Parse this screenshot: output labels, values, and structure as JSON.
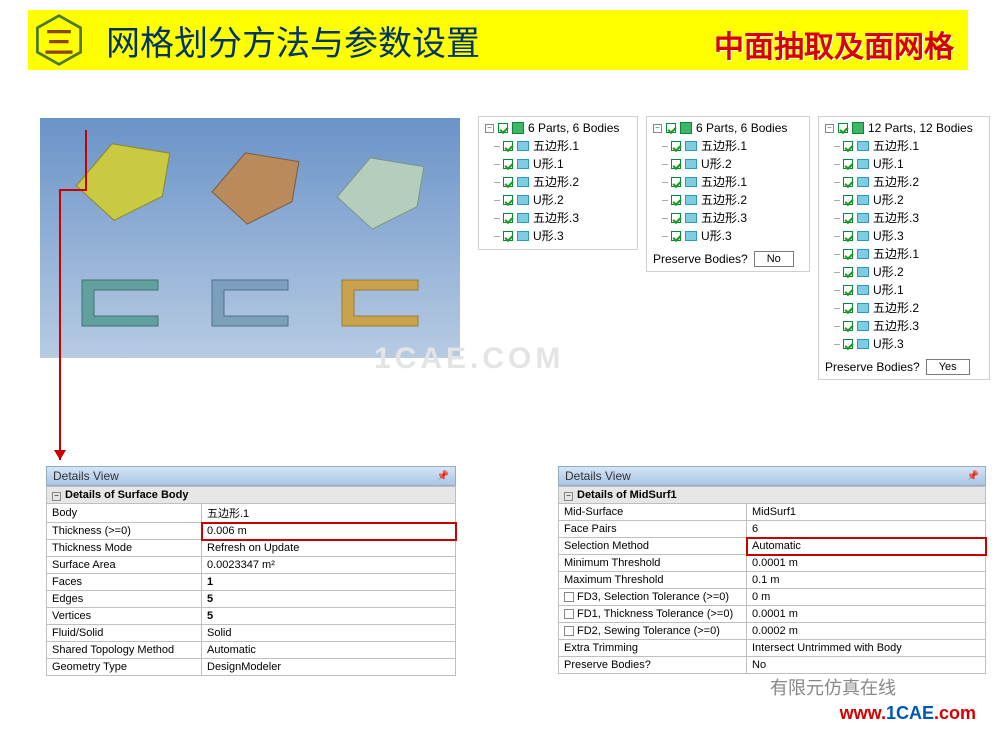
{
  "header": {
    "section_num": "三",
    "title": "网格划分方法与参数设置",
    "subtitle": "中面抽取及面网格"
  },
  "tree1": {
    "root": "6 Parts, 6 Bodies",
    "items": [
      "五边形.1",
      "U形.1",
      "五边形.2",
      "U形.2",
      "五边形.3",
      "U形.3"
    ]
  },
  "tree2": {
    "root": "6 Parts, 6 Bodies",
    "items": [
      "五边形.1",
      "U形.2",
      "五边形.1",
      "五边形.2",
      "五边形.3",
      "U形.3"
    ],
    "preserve_label": "Preserve Bodies?",
    "preserve_value": "No"
  },
  "tree3": {
    "root": "12 Parts, 12 Bodies",
    "items": [
      "五边形.1",
      "U形.1",
      "五边形.2",
      "U形.2",
      "五边形.3",
      "U形.3",
      "五边形.1",
      "U形.2",
      "U形.1",
      "五边形.2",
      "五边形.3",
      "U形.3"
    ],
    "preserve_label": "Preserve Bodies?",
    "preserve_value": "Yes"
  },
  "details_left": {
    "header": "Details View",
    "section": "Details of Surface Body",
    "rows": [
      {
        "label": "Body",
        "value": "五边形.1"
      },
      {
        "label": "Thickness (>=0)",
        "value": "0.006 m",
        "highlight": true
      },
      {
        "label": "Thickness Mode",
        "value": "Refresh on Update"
      },
      {
        "label": "Surface Area",
        "value": "0.0023347 m²"
      },
      {
        "label": "Faces",
        "value": "1",
        "bold": true
      },
      {
        "label": "Edges",
        "value": "5",
        "bold": true
      },
      {
        "label": "Vertices",
        "value": "5",
        "bold": true
      },
      {
        "label": "Fluid/Solid",
        "value": "Solid"
      },
      {
        "label": "Shared Topology Method",
        "value": "Automatic"
      },
      {
        "label": "Geometry Type",
        "value": "DesignModeler"
      }
    ]
  },
  "details_right": {
    "header": "Details View",
    "section": "Details of MidSurf1",
    "rows": [
      {
        "label": "Mid-Surface",
        "value": "MidSurf1"
      },
      {
        "label": "Face Pairs",
        "value": "6"
      },
      {
        "label": "Selection Method",
        "value": "Automatic",
        "highlight": true
      },
      {
        "label": "Minimum Threshold",
        "value": "0.0001 m"
      },
      {
        "label": "Maximum Threshold",
        "value": "0.1 m"
      },
      {
        "label": "FD3, Selection Tolerance (>=0)",
        "value": "0 m",
        "chk": true
      },
      {
        "label": "FD1, Thickness Tolerance (>=0)",
        "value": "0.0001 m",
        "chk": true
      },
      {
        "label": "FD2, Sewing Tolerance (>=0)",
        "value": "0.0002 m",
        "chk": true
      },
      {
        "label": "Extra Trimming",
        "value": "Intersect Untrimmed with Body"
      },
      {
        "label": "Preserve Bodies?",
        "value": "No"
      }
    ]
  },
  "watermark": "1CAE.COM",
  "watermark_cn": "有限元仿真在线",
  "url": "www.1CAE.com"
}
